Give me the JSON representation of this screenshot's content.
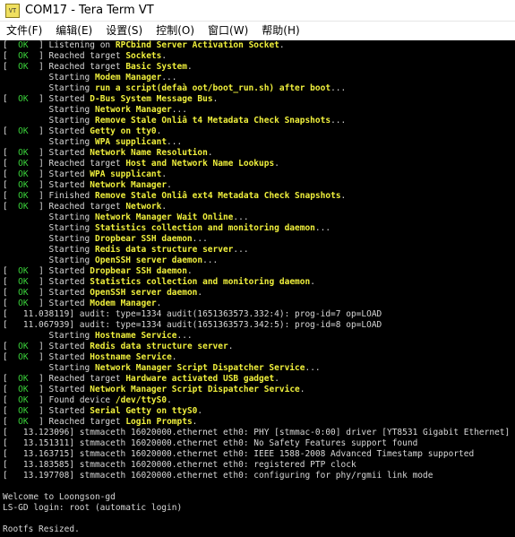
{
  "window": {
    "title": "COM17 - Tera Term VT",
    "icon_label": "VT"
  },
  "menu": [
    "文件(F)",
    "编辑(E)",
    "设置(S)",
    "控制(O)",
    "窗口(W)",
    "帮助(H)"
  ],
  "colors": {
    "ok": "#3ad13a",
    "highlight": "#f0f03c",
    "text": "#d8d8d8",
    "background": "#000000"
  },
  "terminal_lines": [
    {
      "status": "OK",
      "pre": "Listening on ",
      "hl": "RPCbind Server Activation Socket",
      "post": "."
    },
    {
      "status": "OK",
      "pre": "Reached target ",
      "hl": "Sockets",
      "post": "."
    },
    {
      "status": "OK",
      "pre": "Reached target ",
      "hl": "Basic System",
      "post": "."
    },
    {
      "status": "",
      "pre": "Starting ",
      "hl": "Modem Manager",
      "post": "..."
    },
    {
      "status": "",
      "pre": "Starting ",
      "hl": "run a script(defaà oot/boot_run.sh) after boot",
      "post": "..."
    },
    {
      "status": "OK",
      "pre": "Started ",
      "hl": "D-Bus System Message Bus",
      "post": "."
    },
    {
      "status": "",
      "pre": "Starting ",
      "hl": "Network Manager",
      "post": "..."
    },
    {
      "status": "",
      "pre": "Starting ",
      "hl": "Remove Stale Onliâ t4 Metadata Check Snapshots",
      "post": "..."
    },
    {
      "status": "OK",
      "pre": "Started ",
      "hl": "Getty on tty0",
      "post": "."
    },
    {
      "status": "",
      "pre": "Starting ",
      "hl": "WPA supplicant",
      "post": "..."
    },
    {
      "status": "OK",
      "pre": "Started ",
      "hl": "Network Name Resolution",
      "post": "."
    },
    {
      "status": "OK",
      "pre": "Reached target ",
      "hl": "Host and Network Name Lookups",
      "post": "."
    },
    {
      "status": "OK",
      "pre": "Started ",
      "hl": "WPA supplicant",
      "post": "."
    },
    {
      "status": "OK",
      "pre": "Started ",
      "hl": "Network Manager",
      "post": "."
    },
    {
      "status": "OK",
      "pre": "Finished ",
      "hl": "Remove Stale Onliâ ext4 Metadata Check Snapshots",
      "post": "."
    },
    {
      "status": "OK",
      "pre": "Reached target ",
      "hl": "Network",
      "post": "."
    },
    {
      "status": "",
      "pre": "Starting ",
      "hl": "Network Manager Wait Online",
      "post": "..."
    },
    {
      "status": "",
      "pre": "Starting ",
      "hl": "Statistics collection and monitoring daemon",
      "post": "..."
    },
    {
      "status": "",
      "pre": "Starting ",
      "hl": "Dropbear SSH daemon",
      "post": "..."
    },
    {
      "status": "",
      "pre": "Starting ",
      "hl": "Redis data structure server",
      "post": "..."
    },
    {
      "status": "",
      "pre": "Starting ",
      "hl": "OpenSSH server daemon",
      "post": "..."
    },
    {
      "status": "OK",
      "pre": "Started ",
      "hl": "Dropbear SSH daemon",
      "post": "."
    },
    {
      "status": "OK",
      "pre": "Started ",
      "hl": "Statistics collection and monitoring daemon",
      "post": "."
    },
    {
      "status": "OK",
      "pre": "Started ",
      "hl": "OpenSSH server daemon",
      "post": "."
    },
    {
      "status": "OK",
      "pre": "Started ",
      "hl": "Modem Manager",
      "post": "."
    },
    {
      "status": "KERN",
      "pre": "  11.038119] audit: type=1334 audit(1651363573.332:4): prog-id=7 op=LOAD",
      "hl": "",
      "post": ""
    },
    {
      "status": "KERN",
      "pre": "  11.067939] audit: type=1334 audit(1651363573.342:5): prog-id=8 op=LOAD",
      "hl": "",
      "post": ""
    },
    {
      "status": "",
      "pre": "Starting ",
      "hl": "Hostname Service",
      "post": "..."
    },
    {
      "status": "OK",
      "pre": "Started ",
      "hl": "Redis data structure server",
      "post": "."
    },
    {
      "status": "OK",
      "pre": "Started ",
      "hl": "Hostname Service",
      "post": "."
    },
    {
      "status": "",
      "pre": "Starting ",
      "hl": "Network Manager Script Dispatcher Service",
      "post": "..."
    },
    {
      "status": "OK",
      "pre": "Reached target ",
      "hl": "Hardware activated USB gadget",
      "post": "."
    },
    {
      "status": "OK",
      "pre": "Started ",
      "hl": "Network Manager Script Dispatcher Service",
      "post": "."
    },
    {
      "status": "OK",
      "pre": "Found device ",
      "hl": "/dev/ttyS0",
      "post": "."
    },
    {
      "status": "OK",
      "pre": "Started ",
      "hl": "Serial Getty on ttyS0",
      "post": "."
    },
    {
      "status": "OK",
      "pre": "Reached target ",
      "hl": "Login Prompts",
      "post": "."
    },
    {
      "status": "KERN",
      "pre": "  13.123096] stmmaceth 16020000.ethernet eth0: PHY [stmmac-0:00] driver [YT8531 Gigabit Ethernet] (irq=POLL)",
      "hl": "",
      "post": ""
    },
    {
      "status": "KERN",
      "pre": "  13.151311] stmmaceth 16020000.ethernet eth0: No Safety Features support found",
      "hl": "",
      "post": ""
    },
    {
      "status": "KERN",
      "pre": "  13.163715] stmmaceth 16020000.ethernet eth0: IEEE 1588-2008 Advanced Timestamp supported",
      "hl": "",
      "post": ""
    },
    {
      "status": "KERN",
      "pre": "  13.183585] stmmaceth 16020000.ethernet eth0: registered PTP clock",
      "hl": "",
      "post": ""
    },
    {
      "status": "KERN",
      "pre": "  13.197708] stmmaceth 16020000.ethernet eth0: configuring for phy/rgmii link mode",
      "hl": "",
      "post": ""
    },
    {
      "status": "RAW",
      "pre": "",
      "hl": "",
      "post": ""
    },
    {
      "status": "RAW",
      "pre": "Welcome to Loongson-gd",
      "hl": "",
      "post": ""
    },
    {
      "status": "RAW",
      "pre": "LS-GD login: root (automatic login)",
      "hl": "",
      "post": ""
    },
    {
      "status": "RAW",
      "pre": "",
      "hl": "",
      "post": ""
    },
    {
      "status": "RAW",
      "pre": "Rootfs Resized.",
      "hl": "",
      "post": ""
    }
  ]
}
